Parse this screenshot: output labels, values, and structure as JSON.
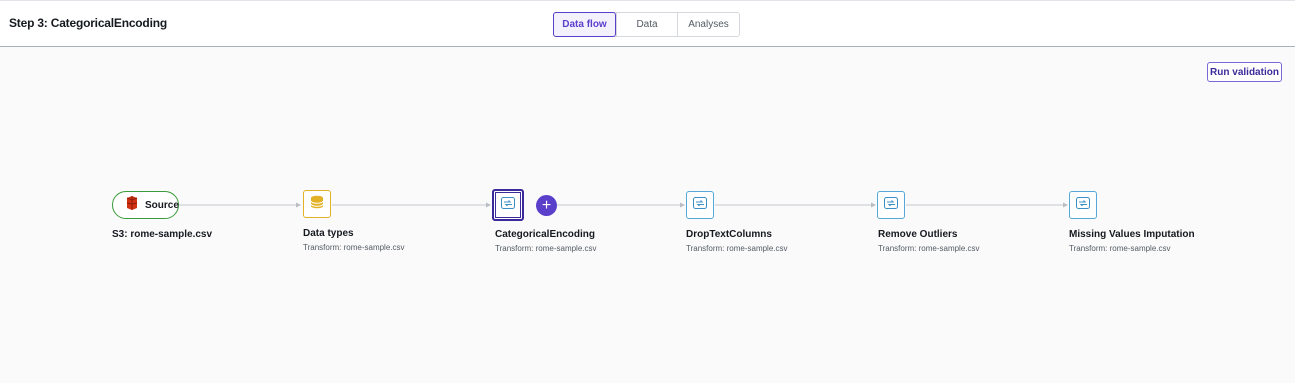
{
  "header": {
    "step_title": "Step 3: CategoricalEncoding",
    "tabs": [
      {
        "label": "Data flow",
        "active": true
      },
      {
        "label": "Data",
        "active": false
      },
      {
        "label": "Analyses",
        "active": false
      }
    ]
  },
  "toolbar": {
    "run_validation_label": "Run validation"
  },
  "colors": {
    "accent": "#5a3fcb",
    "source_border": "#3a9b3a",
    "transform_border": "#55a8d8",
    "datatypes_border": "#e3b126",
    "s3_icon": "#d13212"
  },
  "flow": {
    "source": {
      "label": "Source",
      "title": "S3: rome-sample.csv",
      "icon": "s3-bucket-icon"
    },
    "nodes": [
      {
        "title": "Data types",
        "subtitle": "Transform: rome-sample.csv",
        "icon": "database-icon"
      },
      {
        "title": "CategoricalEncoding",
        "subtitle": "Transform: rome-sample.csv",
        "icon": "transform-icon",
        "selected": true
      },
      {
        "title": "DropTextColumns",
        "subtitle": "Transform: rome-sample.csv",
        "icon": "transform-icon"
      },
      {
        "title": "Remove Outliers",
        "subtitle": "Transform: rome-sample.csv",
        "icon": "transform-icon"
      },
      {
        "title": "Missing Values Imputation",
        "subtitle": "Transform: rome-sample.csv",
        "icon": "transform-icon"
      }
    ],
    "add_step_symbol": "+"
  }
}
